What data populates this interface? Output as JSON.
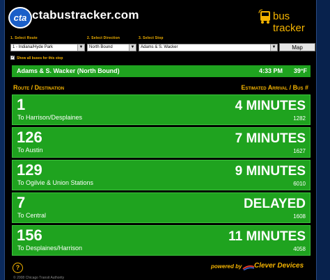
{
  "header": {
    "logo_text": "cta",
    "site_title": "ctabustracker.com",
    "brand": "bus tracker",
    "brand_color": "#f5b400"
  },
  "selectors": {
    "route_label": "1. Select Route",
    "direction_label": "2. Select Direction",
    "stop_label": "3. Select Stop",
    "route_value": "1 - Indiana/Hyde Park",
    "direction_value": "North Bound",
    "stop_value": "Adams & S. Wacker",
    "map_button": "Map",
    "show_all_label": "Show all buses for this stop",
    "show_all_checked": "✓"
  },
  "stop_bar": {
    "stop_name": "Adams & S. Wacker (North Bound)",
    "time": "4:33 PM",
    "temperature": "39°F"
  },
  "columns": {
    "left": "Route / Destination",
    "right": "Estimated Arrival / Bus #"
  },
  "arrivals": [
    {
      "route": "1",
      "destination": "To Harrison/Desplaines",
      "eta": "4 MINUTES",
      "bus": "1282"
    },
    {
      "route": "126",
      "destination": "To Austin",
      "eta": "7 MINUTES",
      "bus": "1627"
    },
    {
      "route": "129",
      "destination": "To Ogilvie & Union Stations",
      "eta": "9 MINUTES",
      "bus": "6010"
    },
    {
      "route": "7",
      "destination": "To Central",
      "eta": "DELAYED",
      "bus": "1608"
    },
    {
      "route": "156",
      "destination": "To Desplaines/Harrison",
      "eta": "11 MINUTES",
      "bus": "4058"
    }
  ],
  "footer": {
    "help": "?",
    "powered_by": "powered by",
    "vendor": "Clever Devices",
    "copyright": "© 2008 Chicago Transit Authority"
  },
  "colors": {
    "row_green": "#1fa31f",
    "background": "#000000",
    "frame": "#0b2a5c"
  }
}
